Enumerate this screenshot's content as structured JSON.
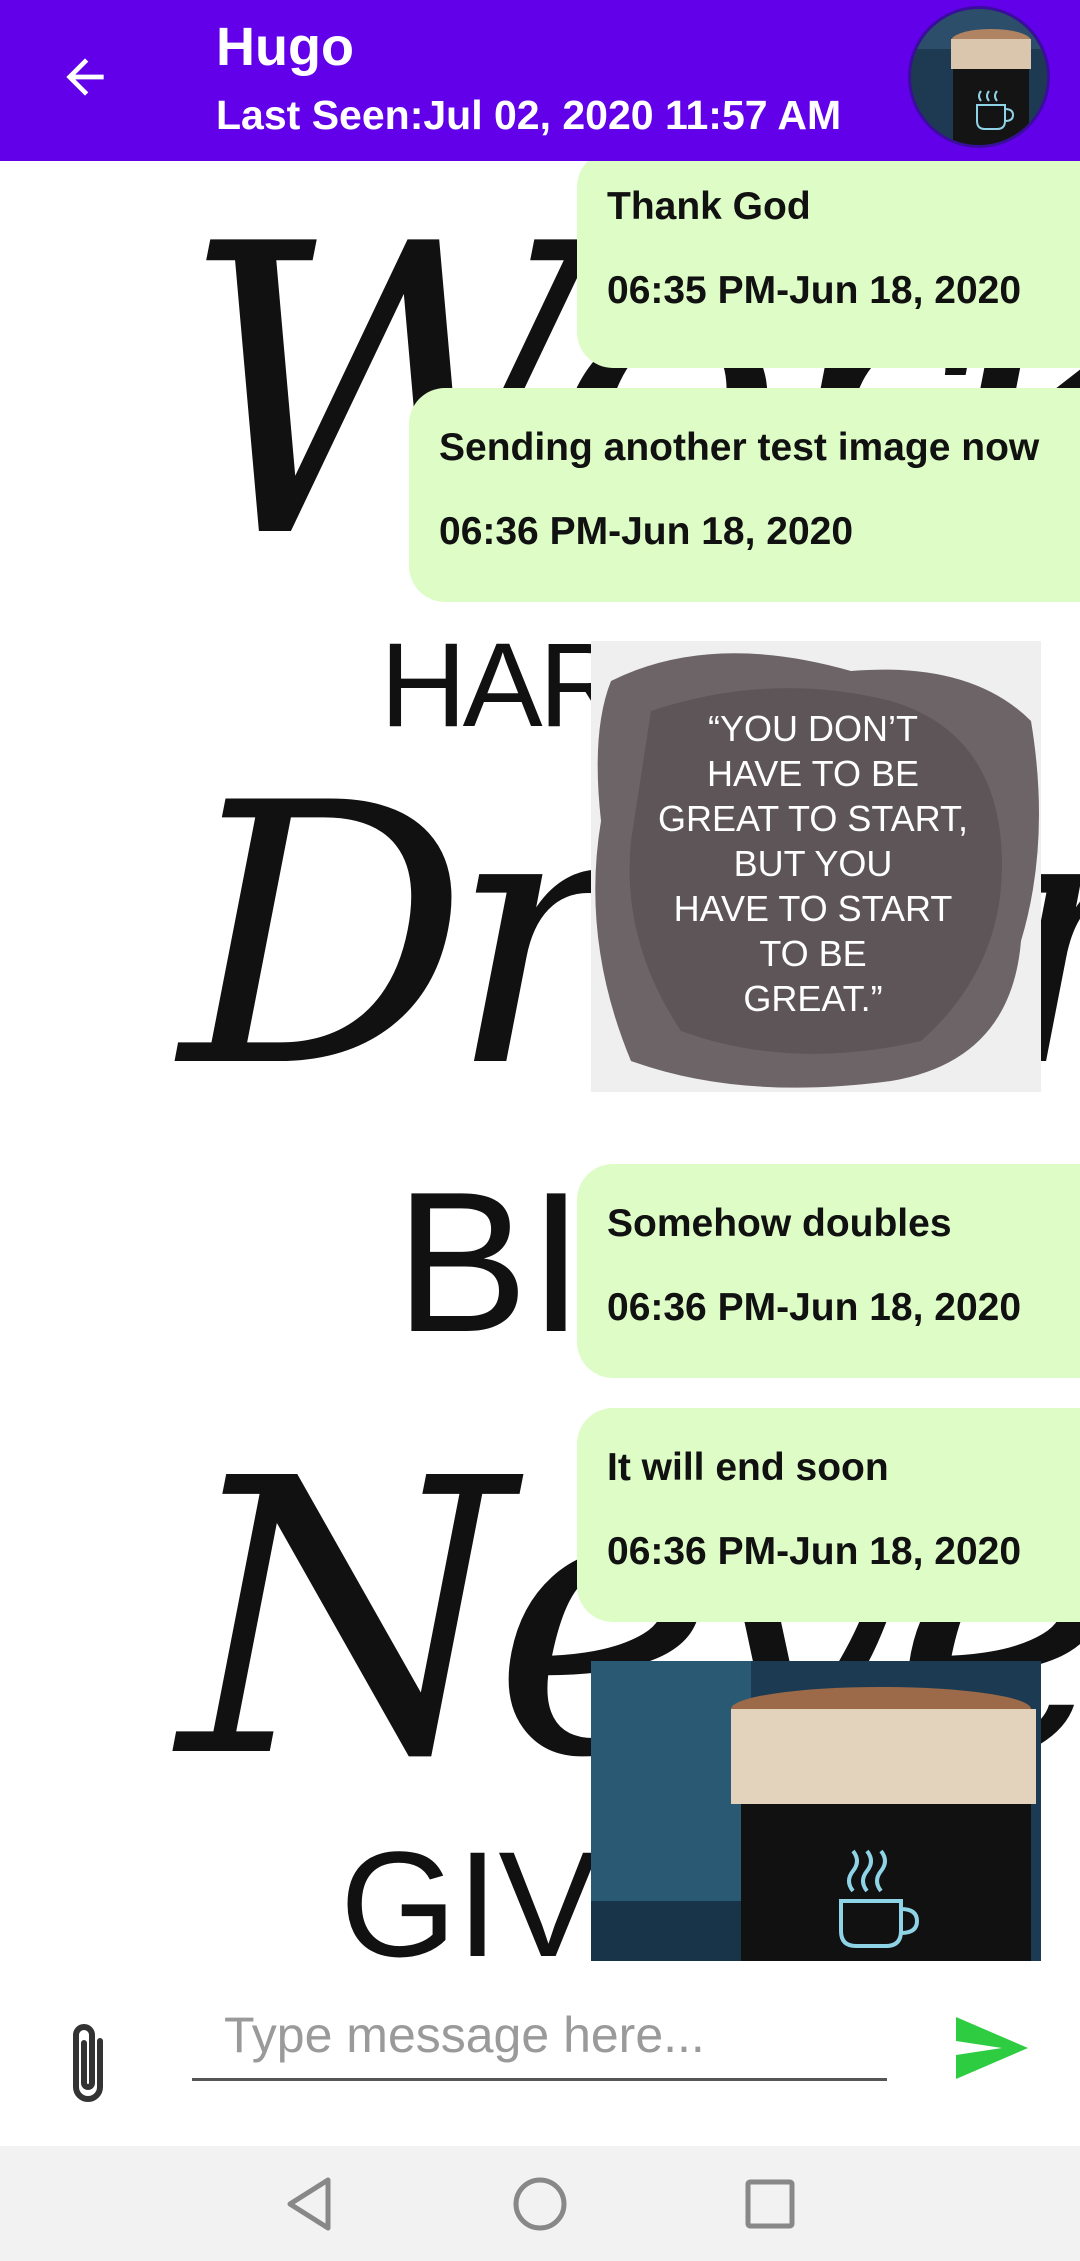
{
  "header": {
    "contact_name": "Hugo",
    "last_seen": "Last Seen:Jul 02, 2020 11:57 AM",
    "color": "#6200ea"
  },
  "wallpaper": {
    "line1": "Work",
    "line2": "HARD",
    "line3": "Dream",
    "line4": "BIG",
    "line5": "Never",
    "line6": "GIVE UP"
  },
  "messages": [
    {
      "type": "text",
      "text": "Thank God",
      "timestamp": "06:35 PM-Jun 18, 2020"
    },
    {
      "type": "text",
      "text": "Sending another test image now",
      "timestamp": "06:36 PM-Jun 18, 2020"
    },
    {
      "type": "image",
      "image_text": "“YOU DON’T HAVE TO BE GREAT TO START, BUT YOU HAVE TO START TO BE GREAT.”",
      "lines": [
        "“YOU DON’T",
        "HAVE TO BE",
        "GREAT TO START,",
        "BUT YOU",
        "HAVE TO START",
        "TO BE",
        "GREAT.”"
      ]
    },
    {
      "type": "text",
      "text": "Somehow doubles",
      "timestamp": "06:36 PM-Jun 18, 2020"
    },
    {
      "type": "text",
      "text": "It will end soon",
      "timestamp": "06:36 PM-Jun 18, 2020"
    },
    {
      "type": "image",
      "image_description": "coffee-cup-photo"
    }
  ],
  "input": {
    "placeholder": "Type message here..."
  },
  "colors": {
    "bubble": "#ddfcc6",
    "send": "#2ecc40"
  }
}
